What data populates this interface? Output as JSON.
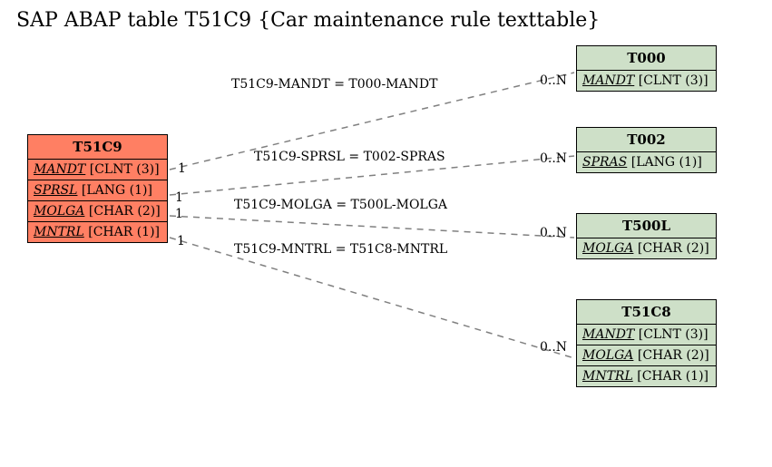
{
  "title": "SAP ABAP table T51C9 {Car maintenance rule texttable}",
  "main_table": {
    "name": "T51C9",
    "fields": [
      {
        "name": "MANDT",
        "type": "CLNT (3)"
      },
      {
        "name": "SPRSL",
        "type": "LANG (1)"
      },
      {
        "name": "MOLGA",
        "type": "CHAR (2)"
      },
      {
        "name": "MNTRL",
        "type": "CHAR (1)"
      }
    ]
  },
  "ref_tables": {
    "t000": {
      "name": "T000",
      "fields": [
        {
          "name": "MANDT",
          "type": "CLNT (3)"
        }
      ]
    },
    "t002": {
      "name": "T002",
      "fields": [
        {
          "name": "SPRAS",
          "type": "LANG (1)"
        }
      ]
    },
    "t500l": {
      "name": "T500L",
      "fields": [
        {
          "name": "MOLGA",
          "type": "CHAR (2)"
        }
      ]
    },
    "t51c8": {
      "name": "T51C8",
      "fields": [
        {
          "name": "MANDT",
          "type": "CLNT (3)"
        },
        {
          "name": "MOLGA",
          "type": "CHAR (2)"
        },
        {
          "name": "MNTRL",
          "type": "CHAR (1)"
        }
      ]
    }
  },
  "relations": [
    {
      "label": "T51C9-MANDT = T000-MANDT",
      "card_left": "1",
      "card_right": "0..N"
    },
    {
      "label": "T51C9-SPRSL = T002-SPRAS",
      "card_left": "1",
      "card_right": "0..N"
    },
    {
      "label": "T51C9-MOLGA = T500L-MOLGA",
      "card_left": "1",
      "card_right": "0..N"
    },
    {
      "label": "T51C9-MNTRL = T51C8-MNTRL",
      "card_left": "1",
      "card_right": "0..N"
    }
  ]
}
